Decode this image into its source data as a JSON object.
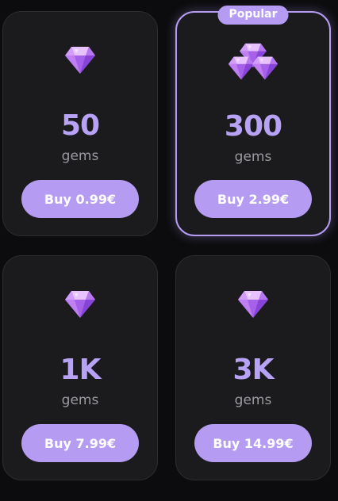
{
  "packs": [
    {
      "amount": "50",
      "unit": "gems",
      "buy_label": "Buy 0.99€",
      "icon": "gem-icon",
      "popular": false
    },
    {
      "amount": "300",
      "unit": "gems",
      "buy_label": "Buy 2.99€",
      "icon": "gem-cluster-icon",
      "popular": true,
      "badge": "Popular"
    },
    {
      "amount": "1K",
      "unit": "gems",
      "buy_label": "Buy 7.99€",
      "icon": "gem-icon",
      "popular": false
    },
    {
      "amount": "3K",
      "unit": "gems",
      "buy_label": "Buy 14.99€",
      "icon": "gem-icon",
      "popular": false
    }
  ],
  "colors": {
    "accent": "#b59cf2",
    "amount_text": "#b7a2f5",
    "card_bg": "#1b1b1e",
    "page_bg": "#0c0c0e"
  }
}
